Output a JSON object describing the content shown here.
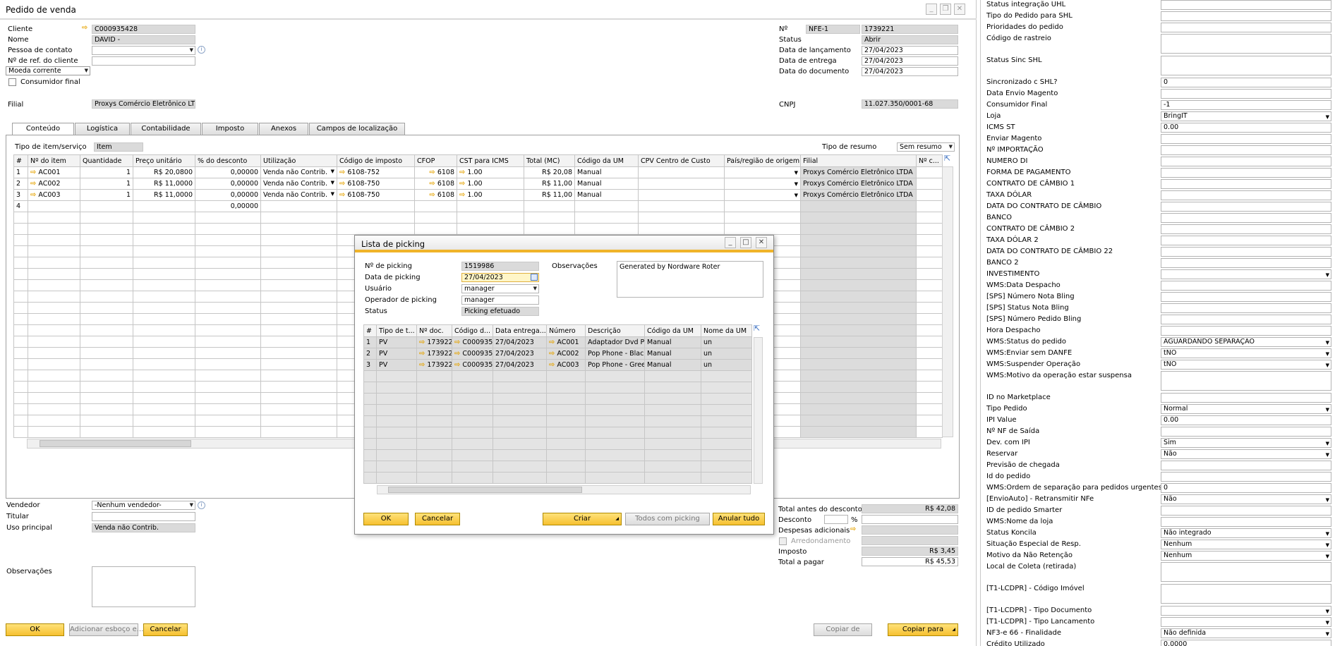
{
  "window": {
    "title": "Pedido de venda"
  },
  "header": {
    "cliente_label": "Cliente",
    "cliente_value": "C000935428",
    "nome_label": "Nome",
    "nome_value": "DAVID -",
    "contato_label": "Pessoa de contato",
    "ref_label": "Nº de ref. do cliente",
    "moeda_value": "Moeda corrente",
    "consumidor_label": "Consumidor final",
    "filial_label": "Filial",
    "filial_value": "Proxys Comércio Eletrônico LTD",
    "no_label": "Nº",
    "serie_value": "NFE-1",
    "no_value": "1739221",
    "status_label": "Status",
    "status_value": "Abrir",
    "lanc_label": "Data de lançamento",
    "lanc_value": "27/04/2023",
    "entrega_label": "Data de entrega",
    "entrega_value": "27/04/2023",
    "doc_label": "Data do documento",
    "doc_value": "27/04/2023",
    "cnpj_label": "CNPJ",
    "cnpj_value": "11.027.350/0001-68"
  },
  "tabs": [
    "Conteúdo",
    "Logística",
    "Contabilidade",
    "Imposto",
    "Anexos",
    "Campos de localização"
  ],
  "content": {
    "tipo_label": "Tipo de item/serviço",
    "tipo_value": "Item",
    "resumo_label": "Tipo de resumo",
    "resumo_value": "Sem resumo",
    "columns": [
      "#",
      "Nº do item",
      "Quantidade",
      "Preço unitário",
      "% do desconto",
      "Utilização",
      "Código de imposto",
      "CFOP",
      "CST para ICMS",
      "Total (MC)",
      "Código da UM",
      "CPV Centro de Custo",
      "País/região de origem",
      "Filial",
      "Nº c..."
    ],
    "rows": [
      {
        "n": "1",
        "item": "AC001",
        "qty": "1",
        "price": "R$ 20,0800",
        "disc": "0,00000",
        "util": "Venda não Contrib.",
        "tax": "6108-752",
        "cfop": "6108",
        "cst": "1.00",
        "total": "R$ 20,08",
        "um": "Manual",
        "filial": "Proxys Comércio Eletrônico LTDA"
      },
      {
        "n": "2",
        "item": "AC002",
        "qty": "1",
        "price": "R$ 11,0000",
        "disc": "0,00000",
        "util": "Venda não Contrib.",
        "tax": "6108-750",
        "cfop": "6108",
        "cst": "1.00",
        "total": "R$ 11,00",
        "um": "Manual",
        "filial": "Proxys Comércio Eletrônico LTDA"
      },
      {
        "n": "3",
        "item": "AC003",
        "qty": "1",
        "price": "R$ 11,0000",
        "disc": "0,00000",
        "util": "Venda não Contrib.",
        "tax": "6108-750",
        "cfop": "6108",
        "cst": "1.00",
        "total": "R$ 11,00",
        "um": "Manual",
        "filial": "Proxys Comércio Eletrônico LTDA"
      },
      {
        "n": "4",
        "item": "",
        "qty": "",
        "price": "",
        "disc": "0,00000",
        "util": "",
        "tax": "",
        "cfop": "",
        "cst": "",
        "total": "",
        "um": "",
        "filial": ""
      }
    ]
  },
  "footer": {
    "vendedor_label": "Vendedor",
    "vendedor_value": "-Nenhum vendedor-",
    "titular_label": "Titular",
    "uso_label": "Uso principal",
    "uso_value": "Venda não Contrib.",
    "obs_label": "Observações",
    "total_antes_label": "Total antes do desconto",
    "total_antes_value": "R$ 42,08",
    "desconto_label": "Desconto",
    "pct": "%",
    "despesas_label": "Despesas adicionais",
    "arred_label": "Arredondamento",
    "imposto_label": "Imposto",
    "imposto_value": "R$ 3,45",
    "total_label": "Total a pagar",
    "total_value": "R$ 45,53",
    "ok": "OK",
    "adicionar": "Adicionar esboço e...",
    "cancelar": "Cancelar",
    "copiar_de": "Copiar de",
    "copiar_para": "Copiar para"
  },
  "picking": {
    "title": "Lista de picking",
    "no_label": "Nº de picking",
    "no_value": "1519986",
    "data_label": "Data de picking",
    "data_value": "27/04/2023",
    "usuario_label": "Usuário",
    "usuario_value": "manager",
    "operador_label": "Operador de picking",
    "operador_value": "manager",
    "status_label": "Status",
    "status_value": "Picking efetuado",
    "obs_label": "Observações",
    "obs_value": "Generated by Nordware Roter",
    "columns": [
      "#",
      "Tipo de t...",
      "Nº doc.",
      "Código d...",
      "Data entrega...",
      "Número",
      "Descrição",
      "Código da UM",
      "Nome da UM"
    ],
    "rows": [
      {
        "n": "1",
        "tipo": "PV",
        "doc": "173922",
        "cod": "C000935",
        "data": "27/04/2023",
        "num": "AC001",
        "desc": "Adaptador Dvd P",
        "um": "Manual",
        "nome": "un"
      },
      {
        "n": "2",
        "tipo": "PV",
        "doc": "173922",
        "cod": "C000935",
        "data": "27/04/2023",
        "num": "AC002",
        "desc": "Pop Phone - Blacl",
        "um": "Manual",
        "nome": "un"
      },
      {
        "n": "3",
        "tipo": "PV",
        "doc": "173922",
        "cod": "C000935",
        "data": "27/04/2023",
        "num": "AC003",
        "desc": "Pop Phone - Gree",
        "um": "Manual",
        "nome": "un"
      }
    ],
    "ok": "OK",
    "cancelar": "Cancelar",
    "criar": "Criar",
    "todos": "Todos com picking",
    "anular": "Anular tudo"
  },
  "right_panel": [
    {
      "label": "Status integração UHL",
      "value": "",
      "type": "text"
    },
    {
      "label": "Tipo do Pedido para SHL",
      "value": "",
      "type": "text"
    },
    {
      "label": "Prioridades do pedido",
      "value": "",
      "type": "text"
    },
    {
      "label": "Código de rastreio",
      "value": "",
      "type": "tall"
    },
    {
      "label": "Status Sinc SHL",
      "value": "",
      "type": "tall"
    },
    {
      "label": "Sincronizado c SHL?",
      "value": "0",
      "type": "text"
    },
    {
      "label": "Data Envio Magento",
      "value": "",
      "type": "text"
    },
    {
      "label": "Consumidor Final",
      "value": "-1",
      "type": "text"
    },
    {
      "label": "Loja",
      "value": "BringIT",
      "type": "select"
    },
    {
      "label": "ICMS ST",
      "value": "0.00",
      "type": "text"
    },
    {
      "label": "Enviar Magento",
      "value": "",
      "type": "text"
    },
    {
      "label": "Nº IMPORTAÇÃO",
      "value": "",
      "type": "text"
    },
    {
      "label": "NUMERO DI",
      "value": "",
      "type": "text"
    },
    {
      "label": "FORMA DE PAGAMENTO",
      "value": "",
      "type": "text"
    },
    {
      "label": "CONTRATO DE CÂMBIO 1",
      "value": "",
      "type": "text"
    },
    {
      "label": "TAXA DÓLAR",
      "value": "",
      "type": "text"
    },
    {
      "label": "DATA DO CONTRATO DE CÂMBIO",
      "value": "",
      "type": "text"
    },
    {
      "label": "BANCO",
      "value": "",
      "type": "text"
    },
    {
      "label": "CONTRATO DE CÂMBIO 2",
      "value": "",
      "type": "text"
    },
    {
      "label": "TAXA DÓLAR 2",
      "value": "",
      "type": "text"
    },
    {
      "label": "DATA DO CONTRATO DE CÂMBIO 22",
      "value": "",
      "type": "text"
    },
    {
      "label": "BANCO 2",
      "value": "",
      "type": "text"
    },
    {
      "label": "INVESTIMENTO",
      "value": "",
      "type": "select"
    },
    {
      "label": "WMS:Data Despacho",
      "value": "",
      "type": "text"
    },
    {
      "label": "[SPS] Número Nota Bling",
      "value": "",
      "type": "text"
    },
    {
      "label": "[SPS] Status Nota Bling",
      "value": "",
      "type": "text"
    },
    {
      "label": "[SPS] Número Pedido Bling",
      "value": "",
      "type": "text"
    },
    {
      "label": "Hora Despacho",
      "value": "",
      "type": "text"
    },
    {
      "label": "WMS:Status do pedido",
      "value": "AGUARDANDO SEPARAÇÃO",
      "type": "select"
    },
    {
      "label": "WMS:Enviar sem DANFE",
      "value": "tNO",
      "type": "select"
    },
    {
      "label": "WMS:Suspender Operação",
      "value": "tNO",
      "type": "select"
    },
    {
      "label": "WMS:Motivo da operação estar suspensa",
      "value": "",
      "type": "tall"
    },
    {
      "label": "ID no Marketplace",
      "value": "",
      "type": "text"
    },
    {
      "label": "Tipo Pedido",
      "value": "Normal",
      "type": "select"
    },
    {
      "label": "IPI Value",
      "value": "0.00",
      "type": "text"
    },
    {
      "label": "Nº NF de Saída",
      "value": "",
      "type": "text"
    },
    {
      "label": "Dev. com IPI",
      "value": "Sim",
      "type": "select"
    },
    {
      "label": "Reservar",
      "value": "Não",
      "type": "select"
    },
    {
      "label": "Previsão de chegada",
      "value": "",
      "type": "text"
    },
    {
      "label": "Id do pedido",
      "value": "",
      "type": "text"
    },
    {
      "label": "WMS:Ordem de separação para pedidos urgentes",
      "value": "0",
      "type": "text"
    },
    {
      "label": "[EnvioAuto] - Retransmitir NFe",
      "value": "Não",
      "type": "select"
    },
    {
      "label": "ID de pedido Smarter",
      "value": "",
      "type": "text"
    },
    {
      "label": "WMS:Nome da loja",
      "value": "",
      "type": "text"
    },
    {
      "label": "Status Koncila",
      "value": "Não integrado",
      "type": "select"
    },
    {
      "label": "Situação Especial de Resp.",
      "value": "Nenhum",
      "type": "select"
    },
    {
      "label": "Motivo da Não Retenção",
      "value": "Nenhum",
      "type": "select"
    },
    {
      "label": "Local de Coleta (retirada)",
      "value": "",
      "type": "tall"
    },
    {
      "label": "[T1-LCDPR] - Código Imóvel",
      "value": "",
      "type": "tall"
    },
    {
      "label": "[T1-LCDPR] - Tipo Documento",
      "value": "",
      "type": "select"
    },
    {
      "label": "[T1-LCDPR] - Tipo Lancamento",
      "value": "",
      "type": "select"
    },
    {
      "label": "NF3-e 66 - Finalidade",
      "value": "Não definida",
      "type": "select"
    },
    {
      "label": "Crédito Utilizado",
      "value": "0,0000",
      "type": "text"
    }
  ]
}
